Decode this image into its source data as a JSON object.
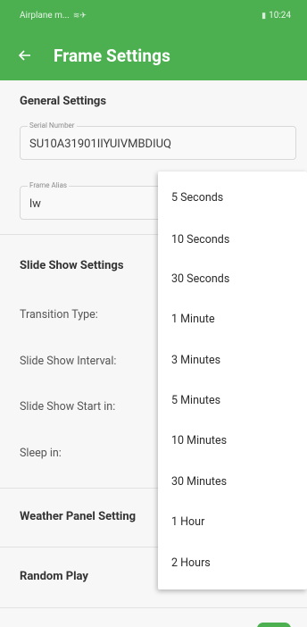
{
  "status_bar": {
    "carrier": "Airplane m...",
    "icons_left": "wifi-airplane-icon",
    "battery_icon": "battery-icon",
    "time": "10:24"
  },
  "app_bar": {
    "back_icon": "arrow-left-icon",
    "title": "Frame Settings"
  },
  "general": {
    "title": "General Settings",
    "serial": {
      "label": "Serial Number",
      "value": "SU10A31901IIYUIVMBDIUQ"
    },
    "alias": {
      "label": "Frame Alias",
      "value": "lw"
    }
  },
  "slideshow": {
    "title": "Slide Show Settings",
    "rows": [
      "Transition Type:",
      "Slide Show Interval:",
      "Slide Show Start in:",
      "Sleep in:"
    ]
  },
  "weather": {
    "title": "Weather Panel Setting"
  },
  "random": {
    "title": "Random Play"
  },
  "dropdown": {
    "options": [
      "5 Seconds",
      "10 Seconds",
      "30 Seconds",
      "1 Minute",
      "3 Minutes",
      "5 Minutes",
      "10 Minutes",
      "30 Minutes",
      "1 Hour",
      "2 Hours"
    ]
  },
  "colors": {
    "accent": "#4caf50"
  }
}
